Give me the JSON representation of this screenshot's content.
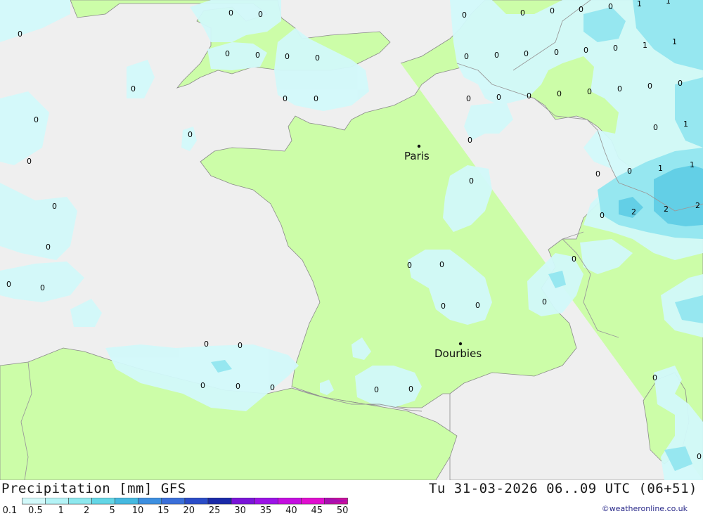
{
  "footer": {
    "title": "Precipitation [mm] GFS",
    "valid": "Tu 31-03-2026 06..09 UTC (06+51)",
    "credit": "©weatheronline.co.uk"
  },
  "legend": {
    "ticks": [
      "0.1",
      "0.5",
      "1",
      "2",
      "5",
      "10",
      "15",
      "20",
      "25",
      "30",
      "35",
      "40",
      "45",
      "50"
    ],
    "colors": [
      "#d2f9fa",
      "#b4f3f6",
      "#8de8ee",
      "#63d6e6",
      "#45b9e0",
      "#3d8fe0",
      "#3a6fd9",
      "#2a4cc7",
      "#1929a8",
      "#7a14d8",
      "#9b12e6",
      "#c40ee0",
      "#e00ecf",
      "#c8109e"
    ]
  },
  "cities": [
    {
      "name": "Paris"
    },
    {
      "name": "Dourbies"
    }
  ],
  "values": [
    "0",
    "1",
    "2"
  ],
  "colors": {
    "sea": "#efefef",
    "land": "#ccfda8",
    "precip_light": "#d2f9fa",
    "precip_mid": "#96e7f0",
    "precip_heavy": "#63cfe6",
    "border": "#9a9a9a"
  }
}
